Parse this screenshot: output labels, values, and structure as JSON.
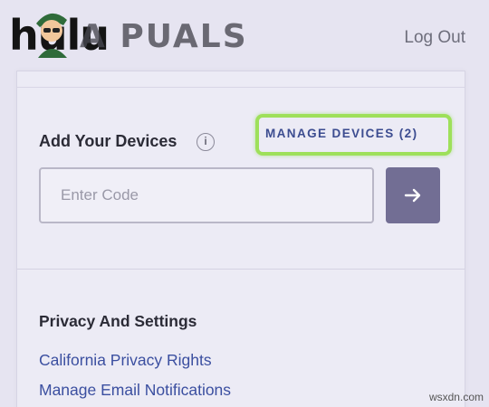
{
  "header": {
    "logo_text": "hulu",
    "watermark_text": "A  PUALS",
    "logout_label": "Log Out"
  },
  "devices": {
    "title": "Add Your Devices",
    "info_symbol": "i",
    "manage_label": "MANAGE DEVICES (2)",
    "code_input": {
      "value": "",
      "placeholder": "Enter Code"
    },
    "submit_symbol": "→"
  },
  "privacy": {
    "title": "Privacy And Settings",
    "links": [
      {
        "label": "California Privacy Rights"
      },
      {
        "label": "Manage Email Notifications"
      }
    ]
  },
  "footer": {
    "site_watermark": "wsxdn.com"
  },
  "colors": {
    "accent_highlight": "#9ee05a",
    "link": "#3b4fa0",
    "button": "#726e94"
  }
}
